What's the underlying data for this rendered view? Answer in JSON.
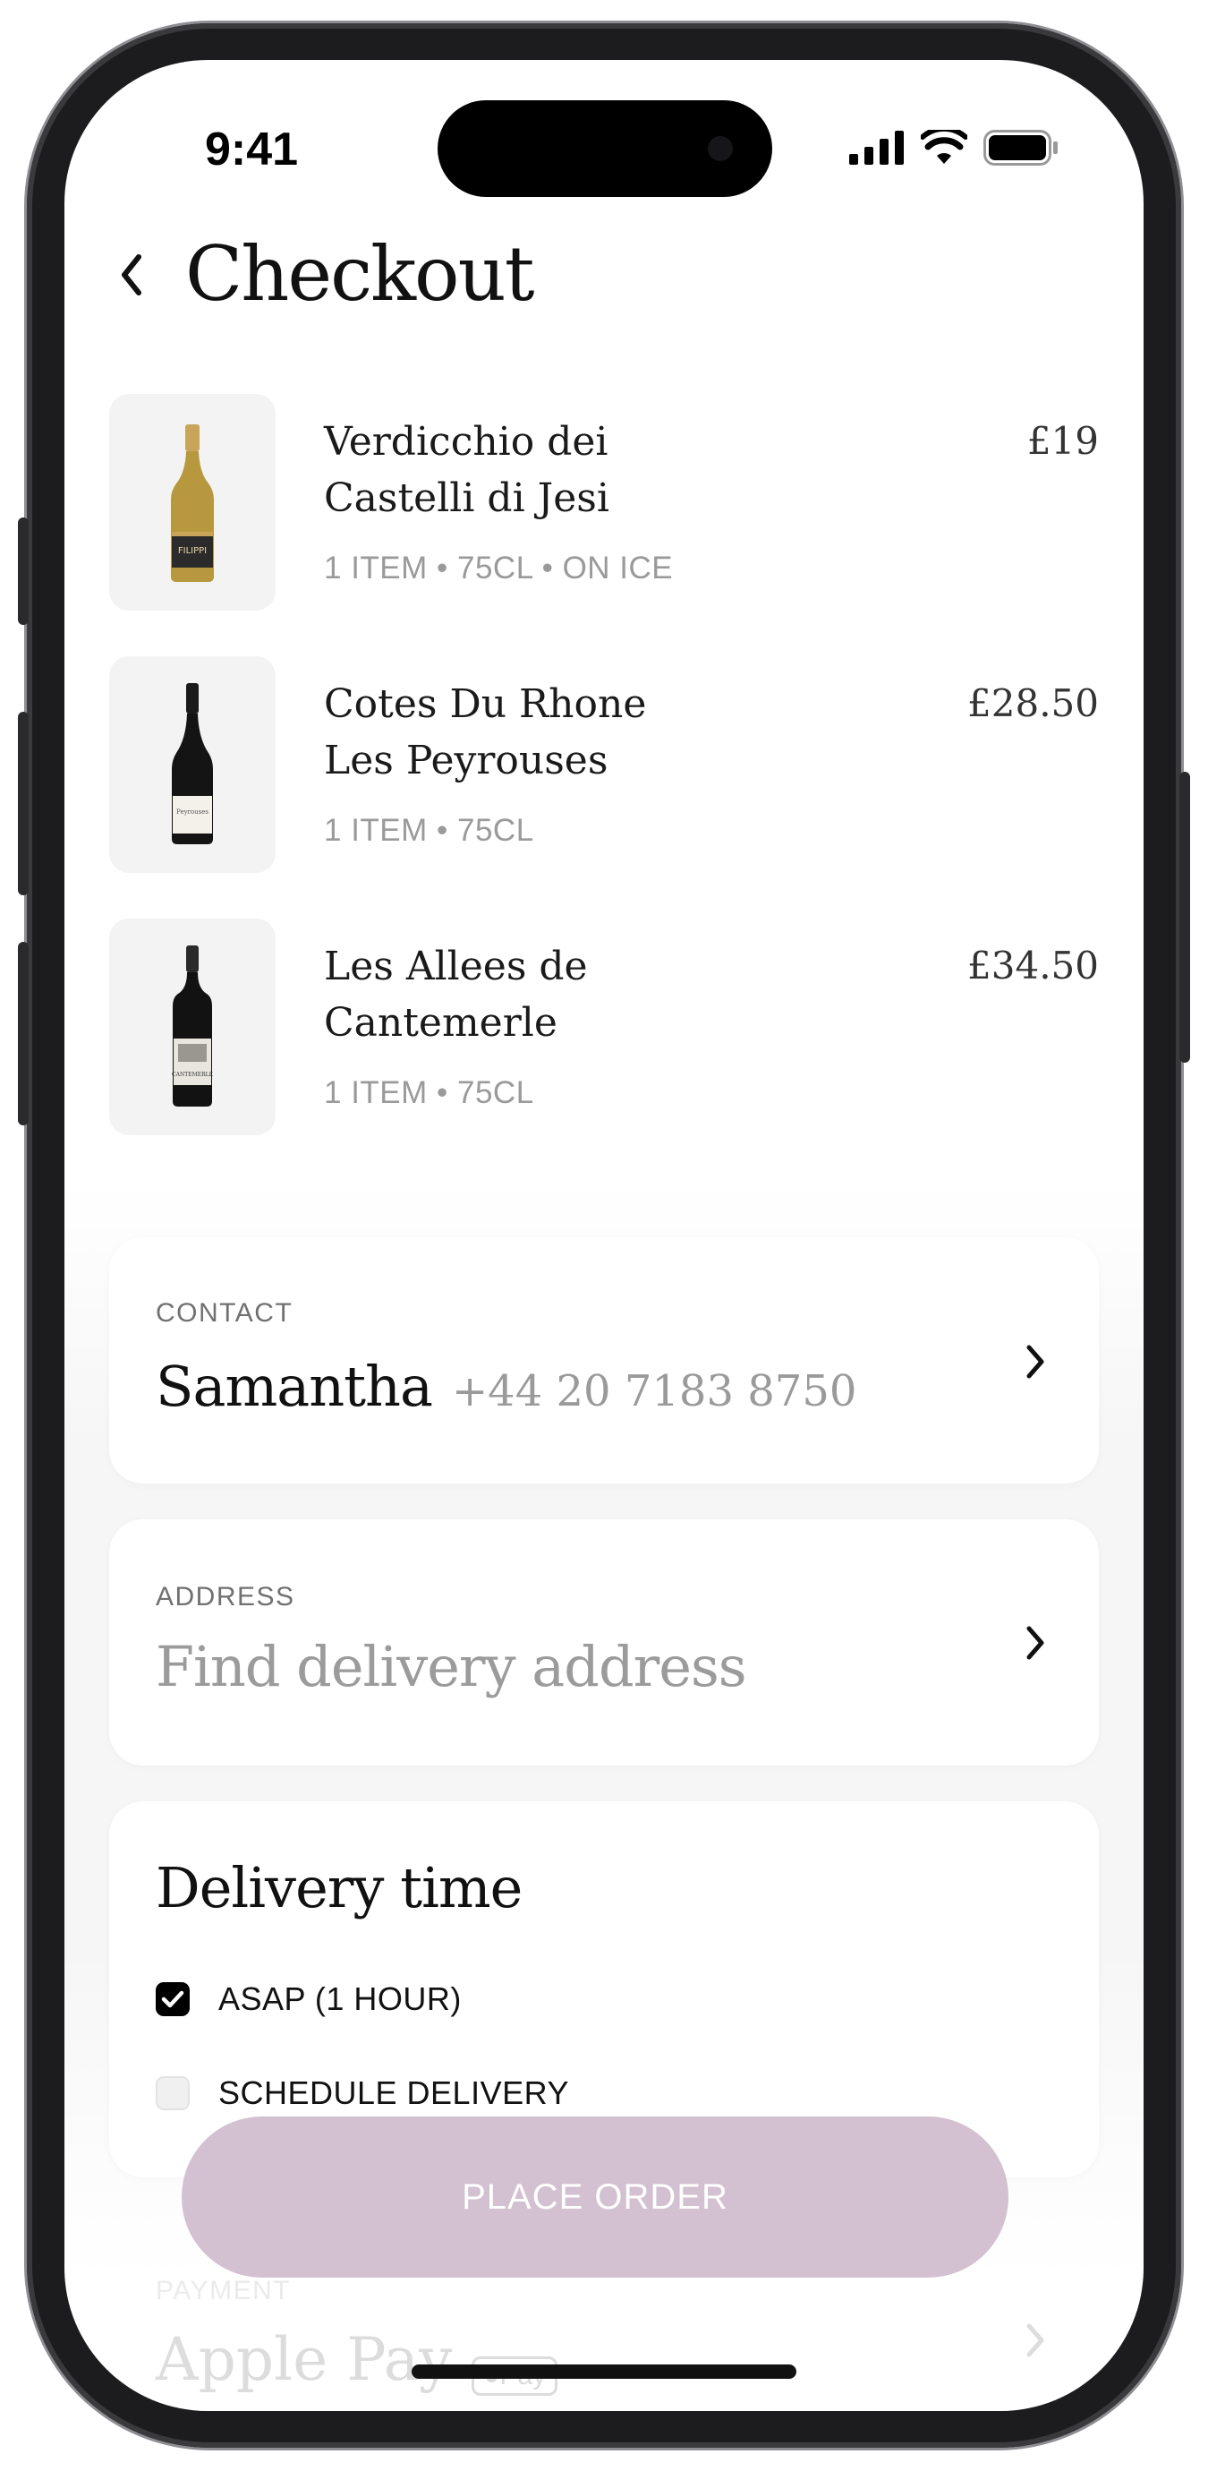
{
  "status_bar": {
    "time": "9:41"
  },
  "header": {
    "title": "Checkout"
  },
  "items": [
    {
      "name_line1": "Verdicchio dei",
      "name_line2": "Castelli di Jesi",
      "meta": "1 ITEM • 75CL • ON ICE",
      "price": "£19",
      "image": "white-wine-bottle"
    },
    {
      "name_line1": "Cotes Du Rhone",
      "name_line2": "Les Peyrouses",
      "meta": "1 ITEM • 75CL",
      "price": "£28.50",
      "image": "red-wine-bottle"
    },
    {
      "name_line1": "Les Allees de",
      "name_line2": "Cantemerle",
      "meta": "1 ITEM • 75CL",
      "price": "£34.50",
      "image": "bordeaux-wine-bottle"
    }
  ],
  "contact": {
    "label": "CONTACT",
    "name": "Samantha",
    "phone": "+44 20 7183 8750"
  },
  "address": {
    "label": "ADDRESS",
    "placeholder": "Find delivery address"
  },
  "delivery": {
    "title": "Delivery time",
    "options": [
      {
        "label": "ASAP (1 HOUR)",
        "checked": true
      },
      {
        "label": "SCHEDULE DELIVERY",
        "checked": false
      }
    ]
  },
  "payment": {
    "label": "PAYMENT",
    "value": "Apple Pay",
    "badge": "Pay"
  },
  "cta": {
    "label": "PLACE ORDER",
    "color": "#d3c0d0"
  },
  "colors": {
    "text": "#111111",
    "muted": "#9a9a9a",
    "card": "#ffffff",
    "thumb_bg": "#f3f3f3"
  }
}
